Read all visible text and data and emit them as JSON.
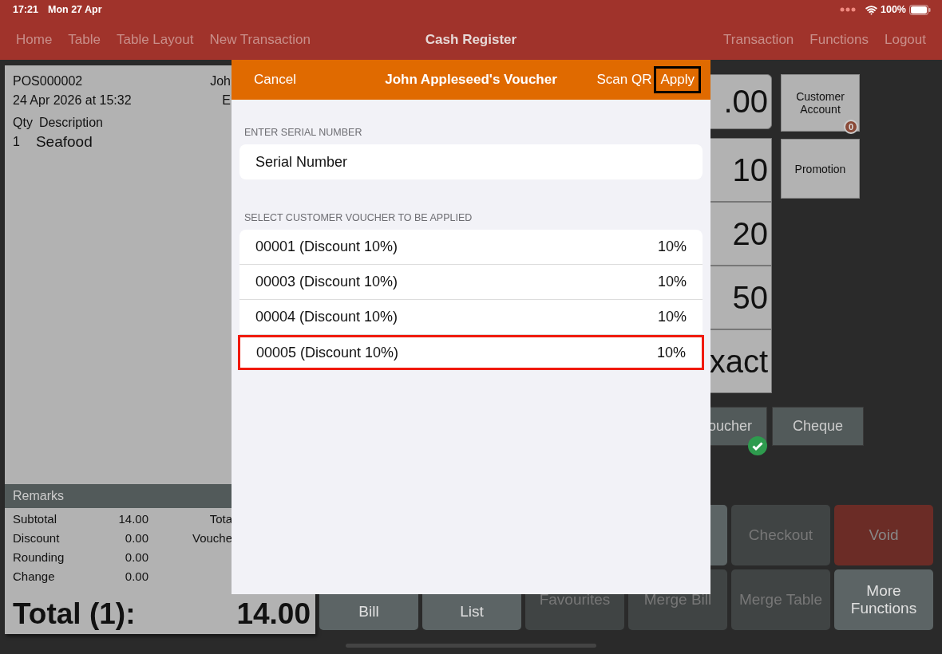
{
  "status_bar": {
    "time": "17:21",
    "date": "Mon 27 Apr",
    "battery": "100%"
  },
  "nav": {
    "left": [
      "Home",
      "Table",
      "Table Layout",
      "New Transaction"
    ],
    "title": "Cash Register",
    "right": [
      "Transaction",
      "Functions",
      "Logout"
    ]
  },
  "receipt": {
    "number": "POS000002",
    "customer": "Joh",
    "date": "24 Apr 2026 at 15:32",
    "column_2": "E",
    "headers": [
      "Qty",
      "Description"
    ],
    "items": [
      {
        "qty": "1",
        "description": "Seafood"
      }
    ],
    "remarks": "Remarks",
    "summary": [
      {
        "label": "Subtotal",
        "value": "14.00",
        "right": "Tota"
      },
      {
        "label": "Discount",
        "value": "0.00",
        "right": "Vouche"
      },
      {
        "label": "Rounding",
        "value": "0.00"
      },
      {
        "label": "Change",
        "value": "0.00"
      }
    ],
    "total_label": "Total (1):",
    "total": "14.00"
  },
  "payment": {
    "amounts": [
      ".00",
      "10",
      "20",
      "50",
      "xact"
    ],
    "side": [
      {
        "label": "Customer Account",
        "badge": "0"
      },
      {
        "label": "Promotion"
      }
    ],
    "methods": [
      {
        "label": "oucher",
        "checked": true
      },
      {
        "label": "Cheque",
        "checked": false
      }
    ]
  },
  "functions": [
    [
      {
        "label": "Checkout",
        "kind": "disabled"
      },
      {
        "label": "Void",
        "kind": "danger"
      }
    ],
    [
      {
        "label": "Bill",
        "kind": "active"
      },
      {
        "label": "List",
        "kind": "active"
      },
      {
        "label": "Favourites",
        "kind": "disabled"
      },
      {
        "label": "Merge Bill",
        "kind": "disabled"
      },
      {
        "label": "Merge Table",
        "kind": "disabled"
      },
      {
        "label": "More Functions",
        "kind": "active"
      }
    ]
  ],
  "dialog": {
    "cancel": "Cancel",
    "title": "John Appleseed's Voucher",
    "scan": "Scan QR",
    "apply": {
      "label": "Apply",
      "highlighted": true
    },
    "serial_section": "ENTER SERIAL NUMBER",
    "serial_placeholder": "Serial Number",
    "voucher_section": "SELECT CUSTOMER VOUCHER TO BE APPLIED",
    "vouchers": [
      {
        "name": "00001 (Discount 10%)",
        "value": "10%",
        "selected": false
      },
      {
        "name": "00003 (Discount 10%)",
        "value": "10%",
        "selected": false
      },
      {
        "name": "00004 (Discount 10%)",
        "value": "10%",
        "selected": false
      },
      {
        "name": "00005 (Discount 10%)",
        "value": "10%",
        "selected": true
      }
    ]
  }
}
